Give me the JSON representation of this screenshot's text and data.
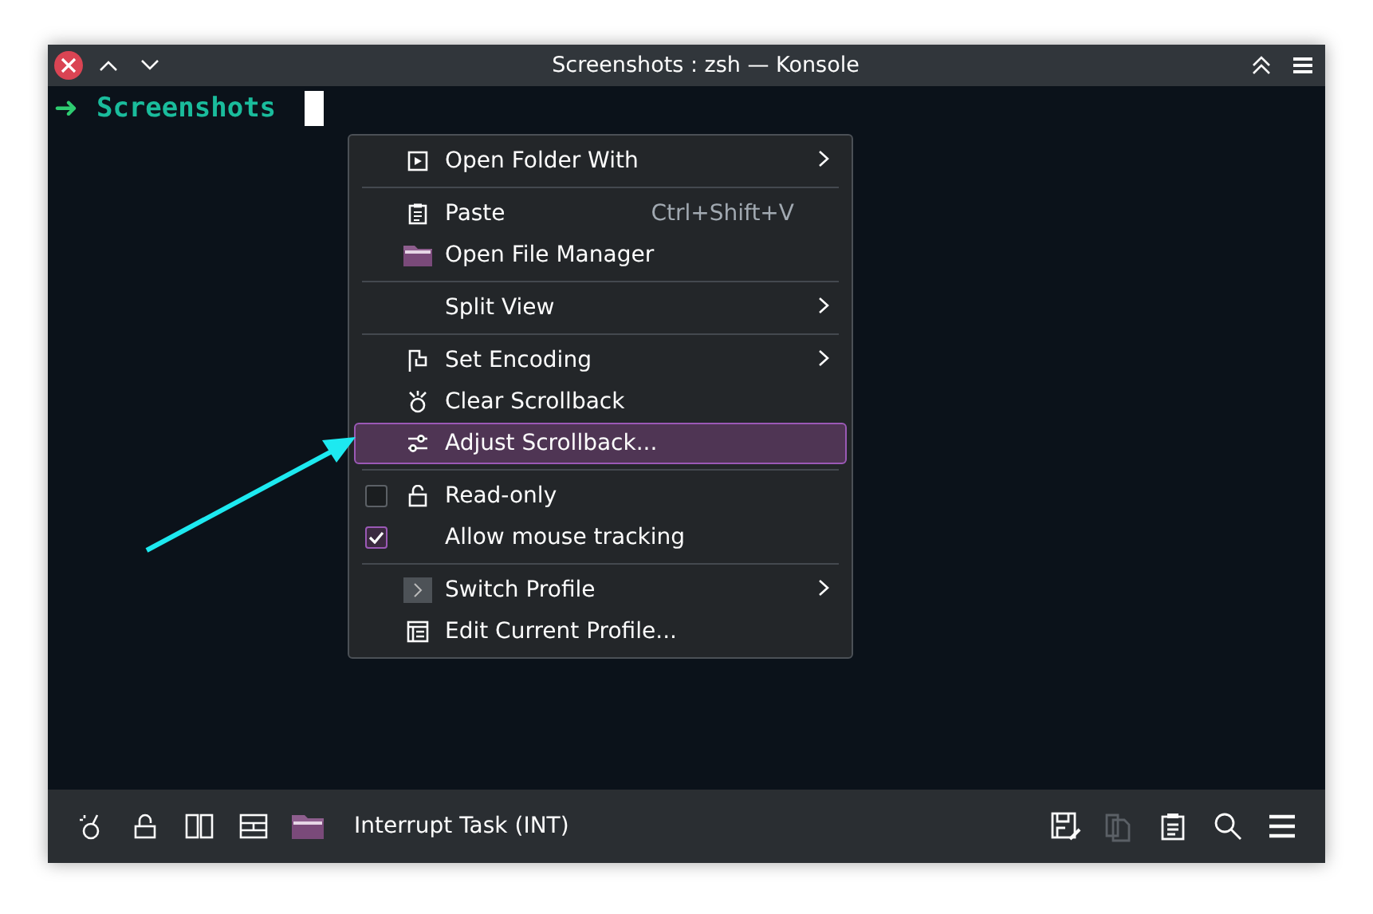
{
  "window": {
    "title": "Screenshots : zsh — Konsole"
  },
  "terminal": {
    "prompt_symbol": "➜",
    "directory": "Screenshots"
  },
  "context_menu": {
    "items": [
      {
        "kind": "action",
        "label": "Open Folder With",
        "submenu": true,
        "selected": false
      },
      {
        "kind": "separator"
      },
      {
        "kind": "action",
        "label": "Paste",
        "shortcut": "Ctrl+Shift+V",
        "submenu": false,
        "selected": false
      },
      {
        "kind": "action",
        "label": "Open File Manager",
        "submenu": false,
        "selected": false
      },
      {
        "kind": "separator"
      },
      {
        "kind": "action",
        "label": "Split View",
        "submenu": true,
        "selected": false
      },
      {
        "kind": "separator"
      },
      {
        "kind": "action",
        "label": "Set Encoding",
        "submenu": true,
        "selected": false
      },
      {
        "kind": "action",
        "label": "Clear Scrollback",
        "submenu": false,
        "selected": false
      },
      {
        "kind": "action",
        "label": "Adjust Scrollback...",
        "submenu": false,
        "selected": true
      },
      {
        "kind": "separator"
      },
      {
        "kind": "checkbox",
        "label": "Read-only",
        "checked": false,
        "selected": false
      },
      {
        "kind": "checkbox",
        "label": "Allow mouse tracking",
        "checked": true,
        "selected": false
      },
      {
        "kind": "separator"
      },
      {
        "kind": "action",
        "label": "Switch Profile",
        "submenu": true,
        "selected": false
      },
      {
        "kind": "action",
        "label": "Edit Current Profile...",
        "submenu": false,
        "selected": false
      }
    ]
  },
  "toolbar": {
    "task_label": "Interrupt Task (INT)",
    "right_buttons": [
      {
        "disabled": false
      },
      {
        "disabled": true
      },
      {
        "disabled": false
      },
      {
        "disabled": false
      },
      {
        "disabled": false
      }
    ]
  }
}
